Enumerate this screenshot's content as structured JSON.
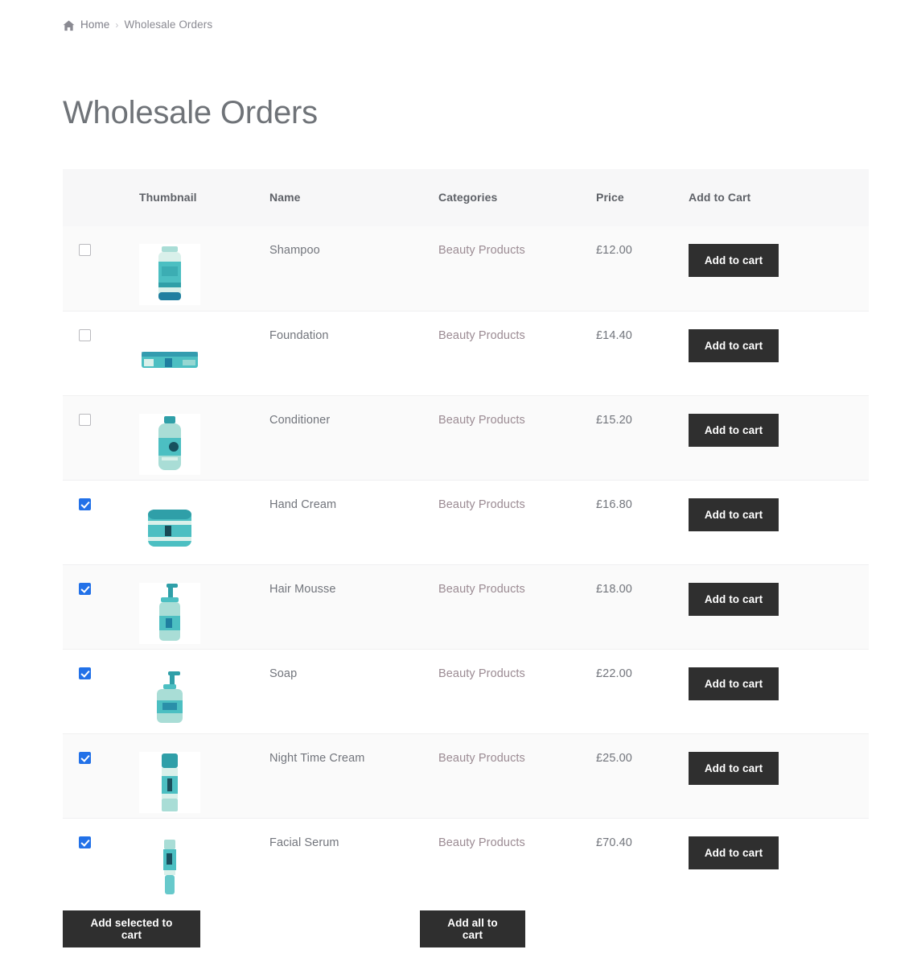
{
  "breadcrumb": {
    "home_icon": "home-icon",
    "home_label": "Home",
    "separator": "›",
    "current": "Wholesale Orders"
  },
  "page_title": "Wholesale Orders",
  "table": {
    "columns": [
      "",
      "Thumbnail",
      "Name",
      "Categories",
      "Price",
      "Add to Cart"
    ],
    "add_to_cart_label": "Add to cart",
    "rows": [
      {
        "selected": false,
        "thumb": "shampoo-bottle",
        "name": "Shampoo",
        "category": "Beauty Products",
        "price": "£12.00"
      },
      {
        "selected": false,
        "thumb": "foundation-palette",
        "name": "Foundation",
        "category": "Beauty Products",
        "price": "£14.40"
      },
      {
        "selected": false,
        "thumb": "conditioner-bottle",
        "name": "Conditioner",
        "category": "Beauty Products",
        "price": "£15.20"
      },
      {
        "selected": true,
        "thumb": "hand-cream-jar",
        "name": "Hand Cream",
        "category": "Beauty Products",
        "price": "£16.80"
      },
      {
        "selected": true,
        "thumb": "hair-mousse-pump",
        "name": "Hair Mousse",
        "category": "Beauty Products",
        "price": "£18.00"
      },
      {
        "selected": true,
        "thumb": "soap-pump",
        "name": "Soap",
        "category": "Beauty Products",
        "price": "£22.00"
      },
      {
        "selected": true,
        "thumb": "night-cream-spray",
        "name": "Night Time Cream",
        "category": "Beauty Products",
        "price": "£25.00"
      },
      {
        "selected": true,
        "thumb": "facial-serum-tube",
        "name": "Facial Serum",
        "category": "Beauty Products",
        "price": "£70.40"
      }
    ]
  },
  "footer": {
    "add_selected_label": "Add selected to cart",
    "add_all_label": "Add all to cart"
  },
  "colors": {
    "button_dark": "#2f2f2f",
    "checkbox_checked": "#2271e8",
    "category_link": "#9b8b93",
    "header_bg": "#f7f7f8",
    "row_alt_bg": "#fafafa",
    "product_teal": "#3fb5ba"
  }
}
